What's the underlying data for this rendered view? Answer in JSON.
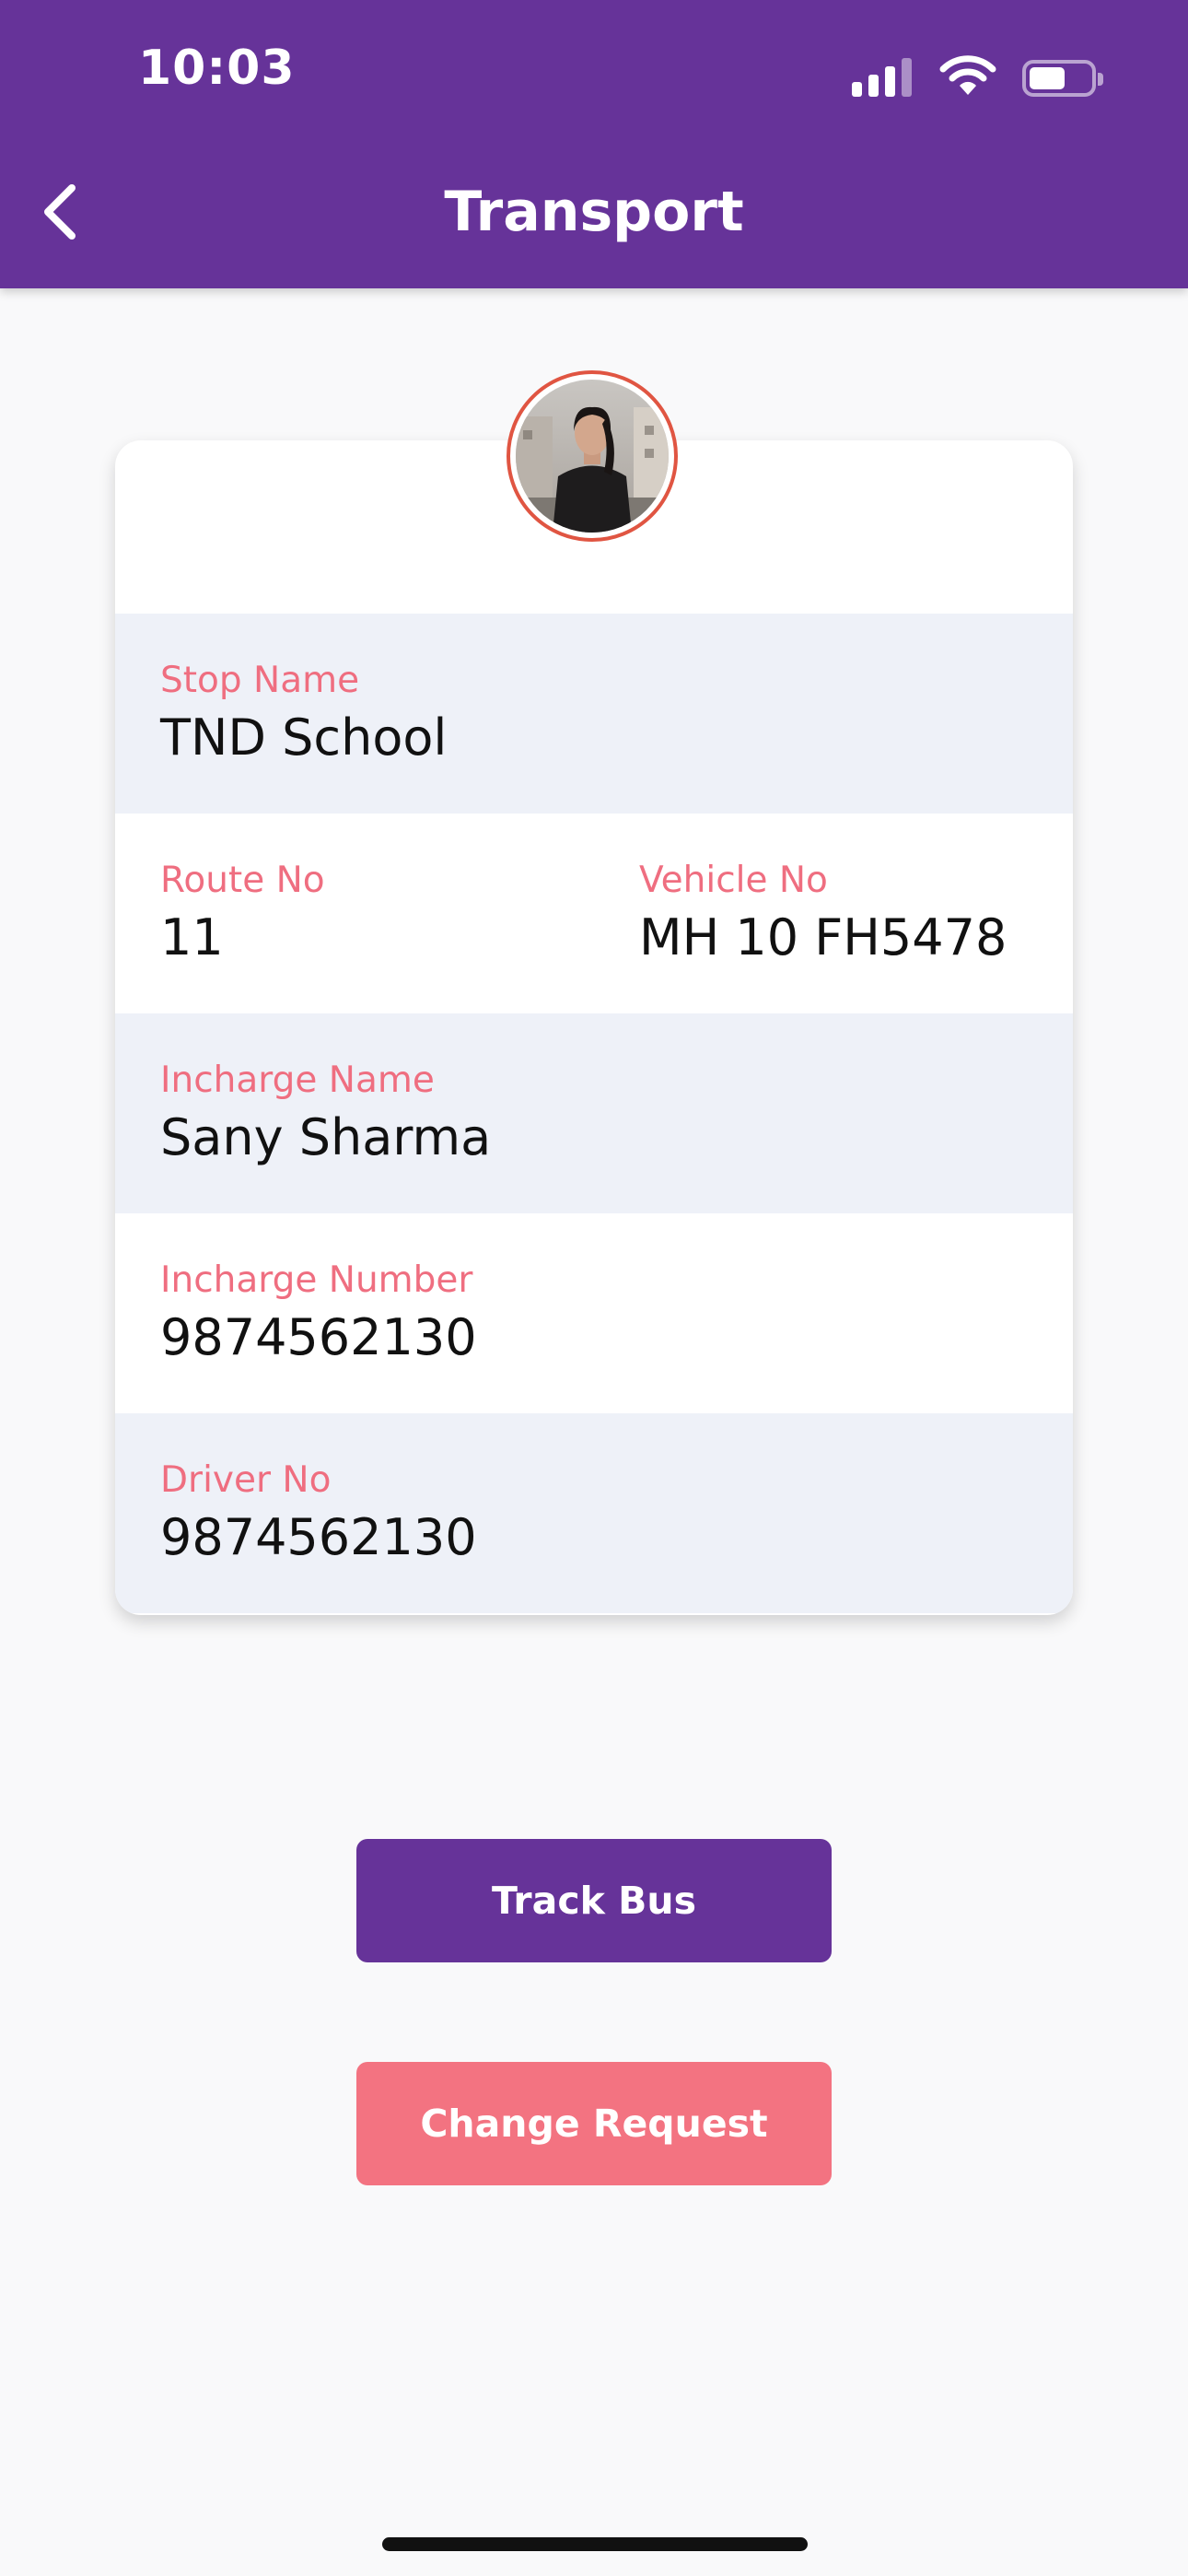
{
  "status_bar": {
    "time": "10:03",
    "icons": [
      "signal-icon",
      "wifi-icon",
      "battery-icon"
    ]
  },
  "header": {
    "title": "Transport",
    "back_icon": "chevron-left-icon",
    "background_color": "#663399"
  },
  "profile": {
    "avatar_icon": "user-photo",
    "ring_color": "#e05542"
  },
  "details": {
    "stop_name": {
      "label": "Stop Name",
      "value": "TND School"
    },
    "route_no": {
      "label": "Route No",
      "value": "11"
    },
    "vehicle_no": {
      "label": "Vehicle No",
      "value": "MH 10 FH5478"
    },
    "incharge_name": {
      "label": "Incharge Name",
      "value": "Sany Sharma"
    },
    "incharge_number": {
      "label": "Incharge Number",
      "value": "9874562130"
    },
    "driver_no": {
      "label": "Driver No",
      "value": "9874562130"
    }
  },
  "actions": {
    "track_bus_label": "Track Bus",
    "change_request_label": "Change Request"
  },
  "colors": {
    "accent": "#663399",
    "label": "#ef6e80",
    "secondary_button": "#f37381",
    "row_shade": "#eef1f8"
  }
}
